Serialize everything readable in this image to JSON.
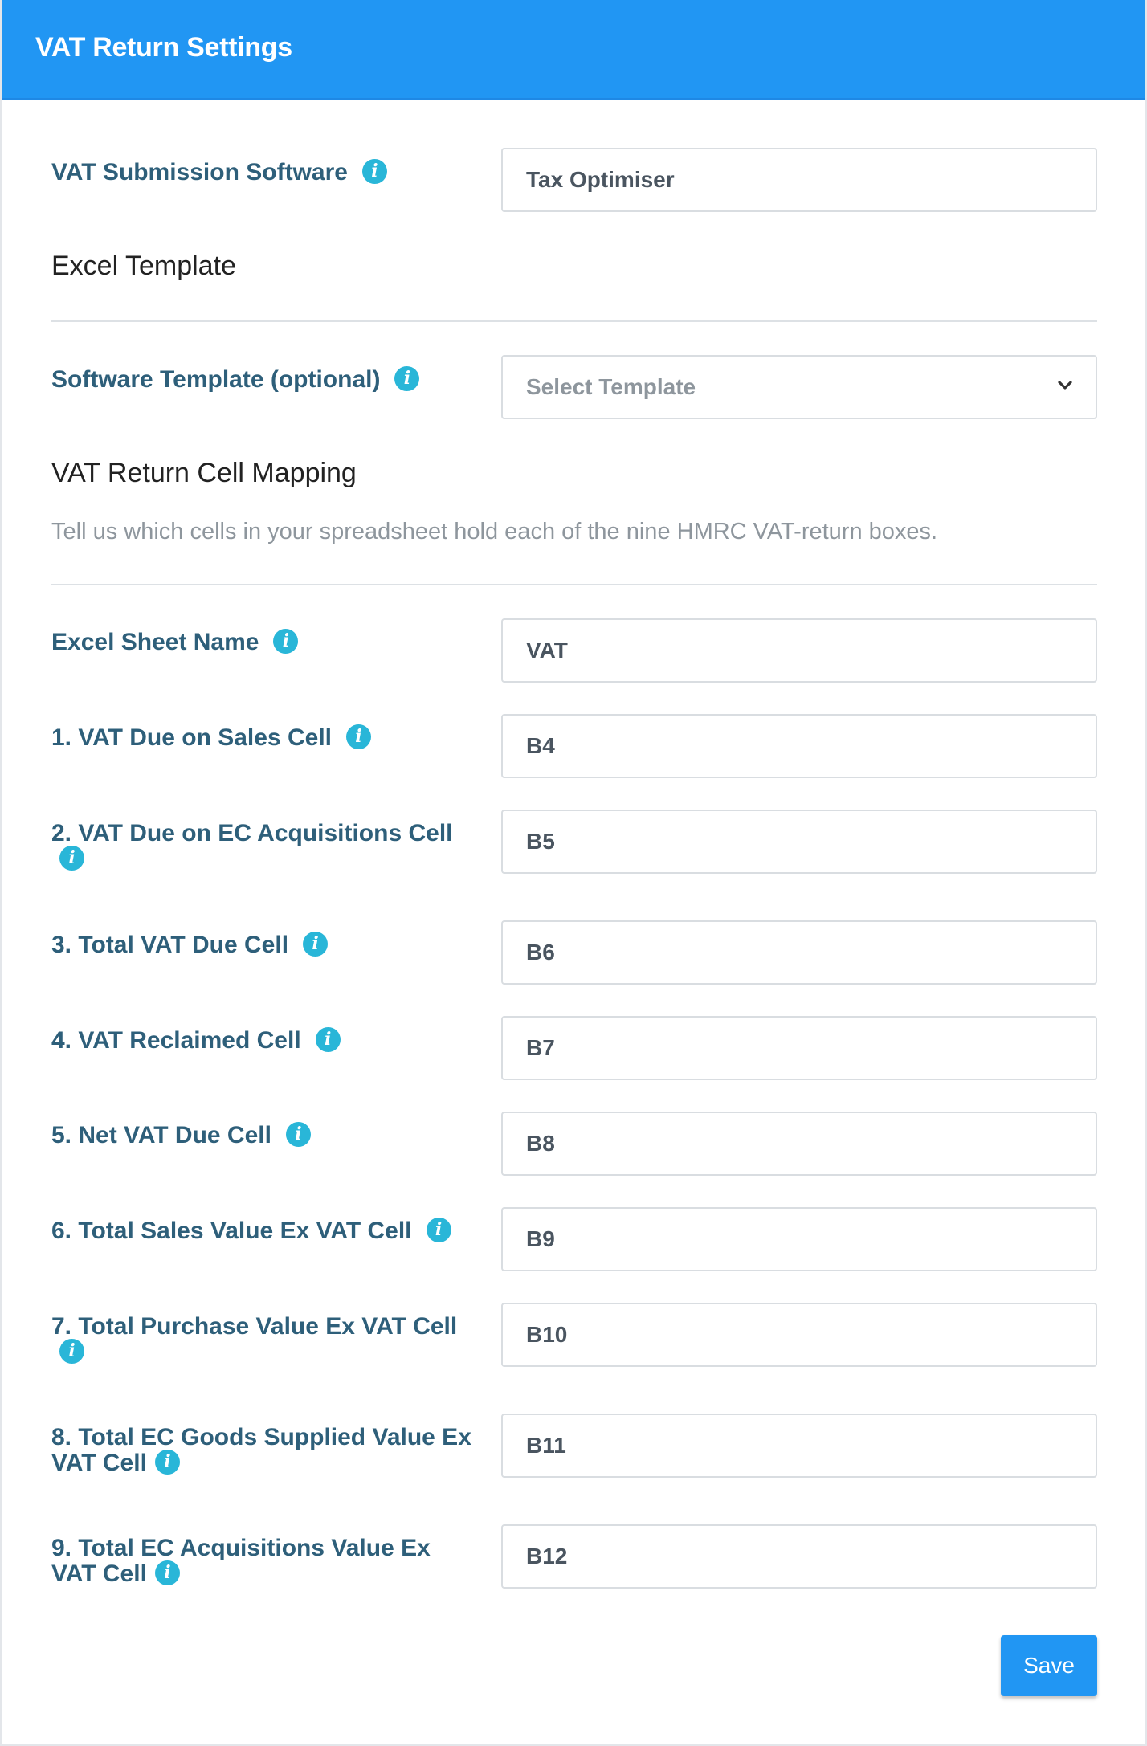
{
  "header": {
    "title": "VAT Return Settings"
  },
  "software": {
    "label": "VAT Submission Software",
    "value": "Tax Optimiser"
  },
  "excel_template": {
    "heading": "Excel Template",
    "template_label": "Software Template (optional)",
    "template_placeholder": "Select Template"
  },
  "mapping": {
    "heading": "VAT Return Cell Mapping",
    "hint": "Tell us which cells in your spreadsheet hold each of the nine HMRC VAT-return boxes.",
    "sheet_label": "Excel Sheet Name",
    "sheet_value": "VAT",
    "rows": [
      {
        "label": "1. VAT Due on Sales Cell",
        "value": "B4"
      },
      {
        "label": "2. VAT Due on EC Acquisitions Cell",
        "value": "B5"
      },
      {
        "label": "3. Total VAT Due Cell",
        "value": "B6"
      },
      {
        "label": "4. VAT Reclaimed Cell",
        "value": "B7"
      },
      {
        "label": "5. Net VAT Due Cell",
        "value": "B8"
      },
      {
        "label": "6. Total Sales Value Ex VAT Cell",
        "value": "B9"
      },
      {
        "label": "7. Total Purchase Value Ex VAT Cell",
        "value": "B10"
      },
      {
        "label": "8. Total EC Goods Supplied Value Ex VAT Cell",
        "value": "B11"
      },
      {
        "label": "9. Total EC Acquisitions Value Ex VAT Cell",
        "value": "B12"
      }
    ]
  },
  "actions": {
    "save_label": "Save"
  },
  "icons": {
    "info": "info-icon",
    "dropdown": "chevron-down-icon"
  },
  "colors": {
    "header": "#2196f3",
    "label": "#2e5f7a",
    "info_icon": "#29b6d8"
  }
}
